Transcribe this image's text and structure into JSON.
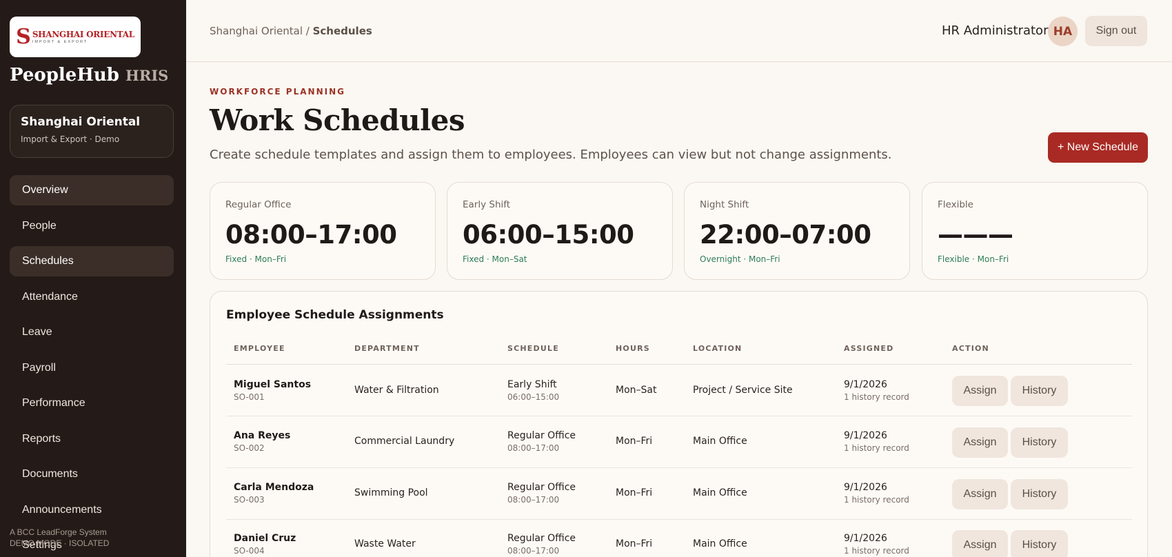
{
  "sidebar": {
    "logo": {
      "letter": "S",
      "main": "SHANGHAI ORIENTAL",
      "sub": "IMPORT & EXPORT"
    },
    "brand": {
      "name": "PeopleHub",
      "suffix": "HRIS"
    },
    "org": {
      "name": "Shanghai Oriental",
      "sub": "Import & Export · Demo"
    },
    "nav": [
      {
        "label": "Overview",
        "active": true
      },
      {
        "label": "People",
        "active": false
      },
      {
        "label": "Schedules",
        "active": true
      },
      {
        "label": "Attendance",
        "active": false
      },
      {
        "label": "Leave",
        "active": false
      },
      {
        "label": "Payroll",
        "active": false
      },
      {
        "label": "Performance",
        "active": false
      },
      {
        "label": "Reports",
        "active": false
      },
      {
        "label": "Documents",
        "active": false
      },
      {
        "label": "Announcements",
        "active": false
      },
      {
        "label": "Settings",
        "active": false
      }
    ],
    "footer": {
      "line1": "A BCC LeadForge System",
      "line2": "DEMO MODE · ISOLATED"
    }
  },
  "header": {
    "breadcrumb_root": "Shanghai Oriental",
    "breadcrumb_sep": " / ",
    "breadcrumb_current": "Schedules",
    "user_name": "HR Administrator",
    "avatar_initials": "HA",
    "signout_label": "Sign out"
  },
  "page": {
    "eyebrow": "WORKFORCE PLANNING",
    "title": "Work Schedules",
    "description": "Create schedule templates and assign them to employees. Employees can view but not change assignments.",
    "new_button": "+ New Schedule"
  },
  "templates": [
    {
      "label": "Regular Office",
      "time": "08:00–17:00",
      "meta": "Fixed · Mon–Fri"
    },
    {
      "label": "Early Shift",
      "time": "06:00–15:00",
      "meta": "Fixed · Mon–Sat"
    },
    {
      "label": "Night Shift",
      "time": "22:00–07:00",
      "meta": "Overnight · Mon–Fri"
    },
    {
      "label": "Flexible",
      "time": "———",
      "meta": "Flexible · Mon–Fri"
    }
  ],
  "assignments": {
    "title": "Employee Schedule Assignments",
    "columns": [
      "EMPLOYEE",
      "DEPARTMENT",
      "SCHEDULE",
      "HOURS",
      "LOCATION",
      "ASSIGNED",
      "ACTION"
    ],
    "rows": [
      {
        "name": "Miguel Santos",
        "id": "SO-001",
        "department": "Water & Filtration",
        "schedule": "Early Shift",
        "schedule_time": "06:00–15:00",
        "hours": "Mon–Sat",
        "location": "Project / Service Site",
        "assigned": "9/1/2026",
        "history": "1 history record",
        "assign_label": "Assign",
        "history_label": "History"
      },
      {
        "name": "Ana Reyes",
        "id": "SO-002",
        "department": "Commercial Laundry",
        "schedule": "Regular Office",
        "schedule_time": "08:00–17:00",
        "hours": "Mon–Fri",
        "location": "Main Office",
        "assigned": "9/1/2026",
        "history": "1 history record",
        "assign_label": "Assign",
        "history_label": "History"
      },
      {
        "name": "Carla Mendoza",
        "id": "SO-003",
        "department": "Swimming Pool",
        "schedule": "Regular Office",
        "schedule_time": "08:00–17:00",
        "hours": "Mon–Fri",
        "location": "Main Office",
        "assigned": "9/1/2026",
        "history": "1 history record",
        "assign_label": "Assign",
        "history_label": "History"
      },
      {
        "name": "Daniel Cruz",
        "id": "SO-004",
        "department": "Waste Water",
        "schedule": "Regular Office",
        "schedule_time": "08:00–17:00",
        "hours": "Mon–Fri",
        "location": "Main Office",
        "assigned": "9/1/2026",
        "history": "1 history record",
        "assign_label": "Assign",
        "history_label": "History"
      }
    ]
  },
  "colors": {
    "accent": "#a92a24",
    "sidebar": "#241b18",
    "success": "#2e7d55",
    "background": "#fbf7f2"
  }
}
